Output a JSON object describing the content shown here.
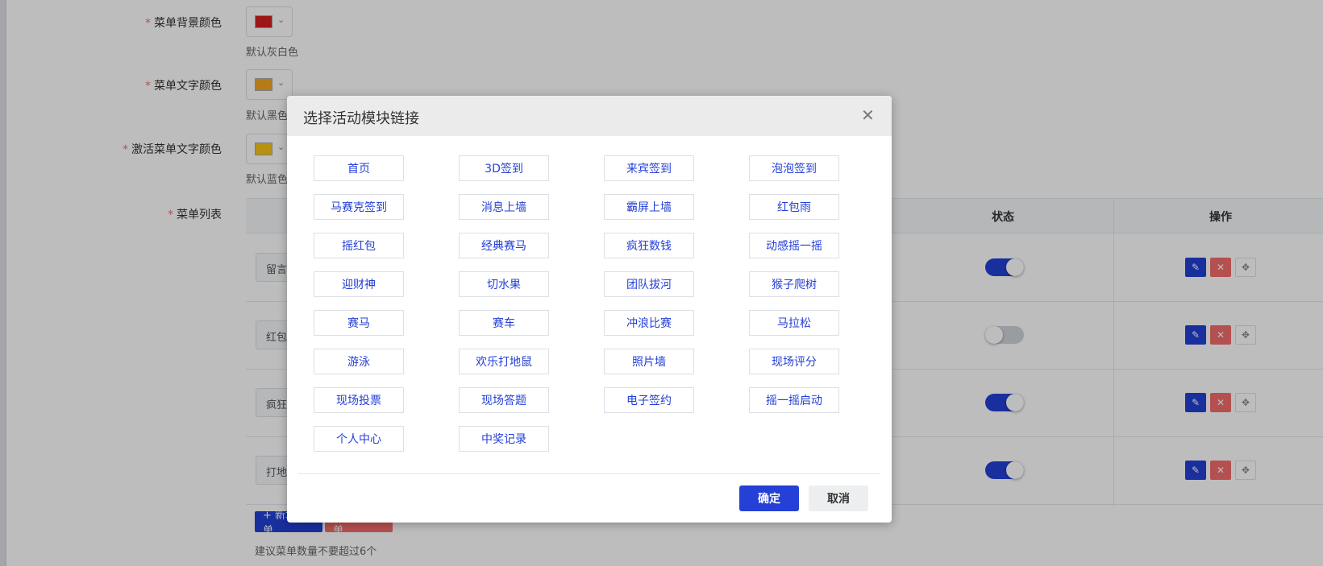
{
  "form": {
    "bg_color": {
      "label": "菜单背景颜色",
      "swatch": "#d42020",
      "hint": "默认灰白色"
    },
    "text_color": {
      "label": "菜单文字颜色",
      "swatch": "#f5a623",
      "hint": "默认黑色"
    },
    "active_text_color": {
      "label": "激活菜单文字颜色",
      "swatch": "#f5c518",
      "hint": "默认蓝色"
    },
    "menu_list": {
      "label": "菜单列表"
    },
    "required_mark": "*",
    "caret": "⌄"
  },
  "table": {
    "status_header": "状态",
    "ops_header": "操作",
    "rows": [
      {
        "name": "留言",
        "enabled": true
      },
      {
        "name": "红包",
        "enabled": false
      },
      {
        "name": "疯狂",
        "enabled": true
      },
      {
        "name": "打地",
        "enabled": true
      }
    ]
  },
  "footer": {
    "add_label": "+ 新增菜单",
    "reset_label": "⟲ 恢复菜单",
    "hint": "建议菜单数量不要超过6个"
  },
  "dialog": {
    "title": "选择活动模块链接",
    "close_glyph": "✕",
    "links": [
      "首页",
      "3D签到",
      "来宾签到",
      "泡泡签到",
      "马赛克签到",
      "消息上墙",
      "霸屏上墙",
      "红包雨",
      "摇红包",
      "经典赛马",
      "疯狂数钱",
      "动感摇一摇",
      "迎财神",
      "切水果",
      "团队拔河",
      "猴子爬树",
      "赛马",
      "赛车",
      "冲浪比赛",
      "马拉松",
      "游泳",
      "欢乐打地鼠",
      "照片墙",
      "现场评分",
      "现场投票",
      "现场答题",
      "电子签约",
      "摇一摇启动",
      "个人中心",
      "中奖记录"
    ],
    "ok_label": "确定",
    "cancel_label": "取消"
  },
  "colors": {
    "primary": "#2440d6",
    "danger": "#f56c6c"
  },
  "icons": {
    "edit": "pencil-icon",
    "delete": "close-icon",
    "move": "move-icon"
  }
}
